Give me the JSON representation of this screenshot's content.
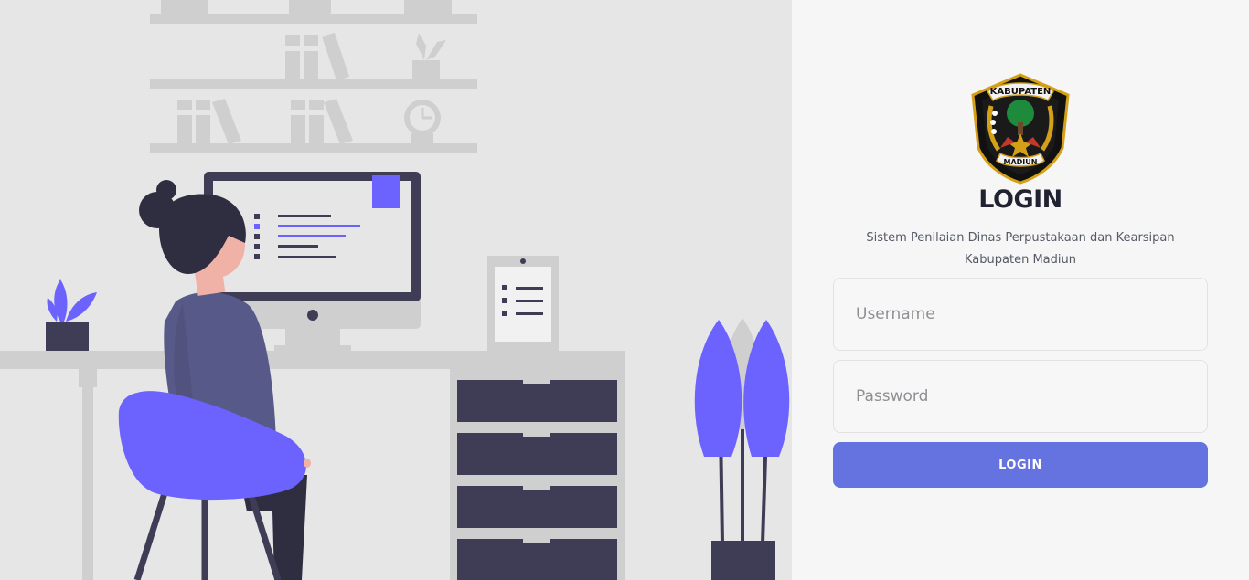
{
  "colors": {
    "illustration_bg": "#e6e6e6",
    "panel_bg": "#f6f6f6",
    "accent_purple": "#6c63ff",
    "dark_navy": "#3f3d56",
    "login_button": "#6573e0"
  },
  "logo": {
    "top_text": "KABUPATEN",
    "bottom_text": "MADIUN",
    "icon": "kabupaten-madiun-emblem"
  },
  "login": {
    "title": "LOGIN",
    "subtitle": "Sistem Penilaian Dinas Perpustakaan dan Kearsipan Kabupaten Madiun",
    "username_placeholder": "Username",
    "password_placeholder": "Password",
    "button_label": "LOGIN"
  }
}
